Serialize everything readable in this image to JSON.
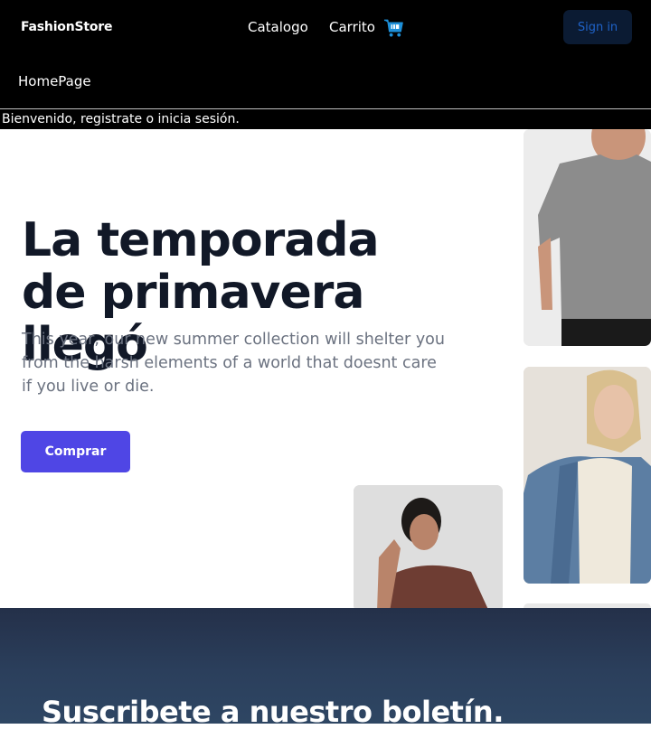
{
  "header": {
    "brand": "FashionStore",
    "nav": {
      "catalogo": "Catalogo",
      "carrito": "Carrito"
    },
    "cart_icon": "shopping-cart-icon",
    "signin_label": "Sign in",
    "homepage_label": "HomePage"
  },
  "welcome": {
    "text": "Bienvenido, registrate o inicia sesión."
  },
  "hero": {
    "title": "La temporada de primavera llegó",
    "text": "This year, our new summer collection will shelter you from the harsh elements of a world that doesnt care if you live or die.",
    "button_label": "Comprar"
  },
  "newsletter": {
    "title": "Suscribete a nuestro boletín."
  },
  "colors": {
    "accent": "#4f46e5",
    "header_bg": "#000000",
    "signin_text": "#1f63c9",
    "cart_icon": "#1d8fd8",
    "newsletter_bg": "#2b3f5c"
  }
}
